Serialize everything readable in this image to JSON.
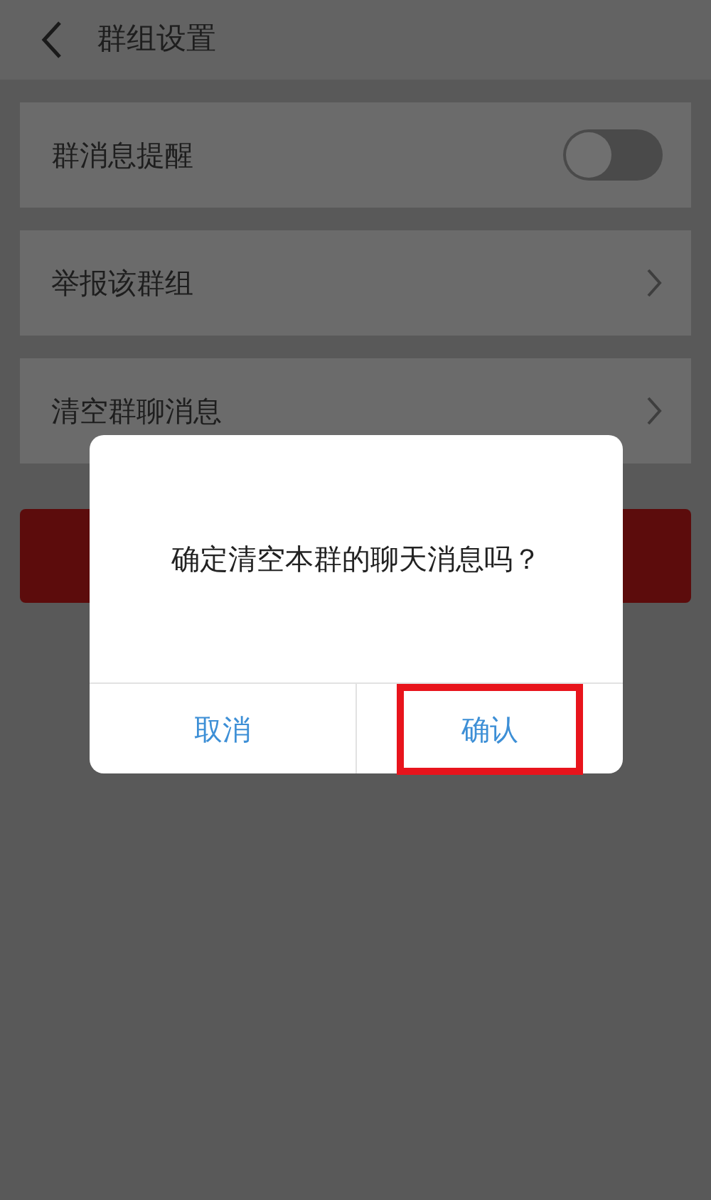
{
  "header": {
    "title": "群组设置"
  },
  "settings": [
    {
      "kind": "toggle",
      "label": "群消息提醒",
      "on": false
    },
    {
      "kind": "link",
      "label": "举报该群组"
    },
    {
      "kind": "link",
      "label": "清空群聊消息"
    }
  ],
  "dialog": {
    "message": "确定清空本群的聊天消息吗？",
    "buttons": [
      {
        "label": "取消",
        "highlighted": false
      },
      {
        "label": "确认",
        "highlighted": true
      }
    ]
  }
}
